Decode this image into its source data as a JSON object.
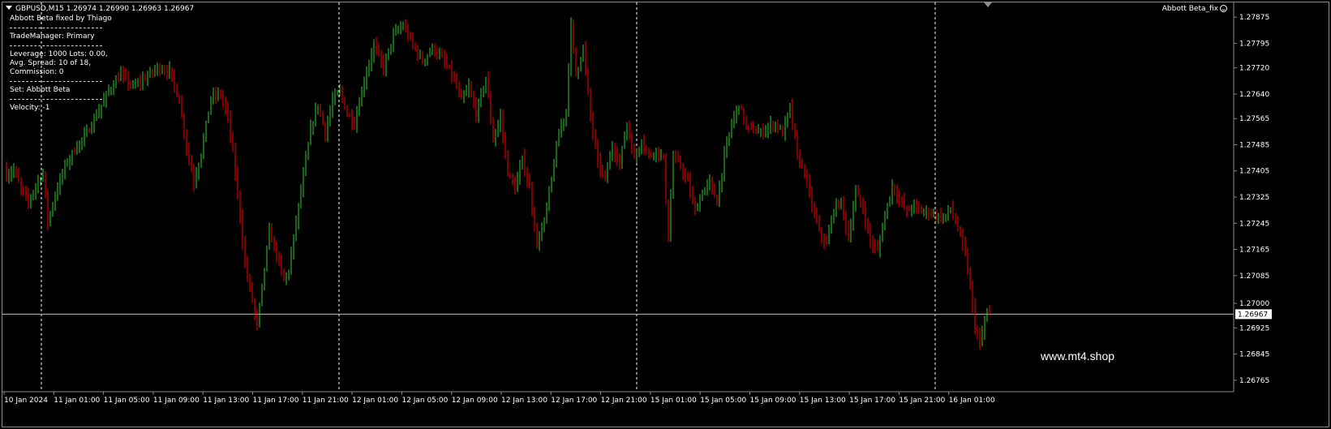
{
  "header": {
    "symbol_line": "GBPUSD,M15  1.26974 1.26990 1.26963 1.26967"
  },
  "info_panel": {
    "title": "Abbott Beta fixed by Thiago",
    "trade_manager": "TradeManager: Primary",
    "leverage_line": "Leverage: 1000 Lots: 0.00,",
    "spread_line": "Avg. Spread: 10 of 18,",
    "commission_line": "Commission: 0",
    "set_line": "Set: Abbott Beta",
    "velocity_line": "Velocity: -1"
  },
  "indicator": {
    "name": "Abbott Beta_fix",
    "icon": "smiley-icon"
  },
  "watermark": "www.mt4.shop",
  "colors": {
    "background": "#000000",
    "bull": "#32cd32",
    "bear": "#ff0000",
    "grid": "#ffffff",
    "price_line": "#c0c0c0",
    "axis_text": "#ffffff"
  },
  "chart_data": {
    "type": "candlestick",
    "symbol": "GBPUSD",
    "timeframe": "M15",
    "ohlc_last": {
      "open": 1.26974,
      "high": 1.2699,
      "low": 1.26963,
      "close": 1.26967
    },
    "current_price": "1.26967",
    "ylim": [
      1.2673,
      1.2792
    ],
    "y_ticks": [
      "1.27875",
      "1.27795",
      "1.27720",
      "1.27640",
      "1.27565",
      "1.27485",
      "1.27405",
      "1.27325",
      "1.27245",
      "1.27165",
      "1.27085",
      "1.27000",
      "1.26925",
      "1.26845",
      "1.26765"
    ],
    "x_ticks": [
      "10 Jan 2024",
      "11 Jan 01:00",
      "11 Jan 05:00",
      "11 Jan 09:00",
      "11 Jan 13:00",
      "11 Jan 17:00",
      "11 Jan 21:00",
      "12 Jan 01:00",
      "12 Jan 05:00",
      "12 Jan 09:00",
      "12 Jan 13:00",
      "12 Jan 17:00",
      "12 Jan 21:00",
      "15 Jan 01:00",
      "15 Jan 05:00",
      "15 Jan 09:00",
      "15 Jan 13:00",
      "15 Jan 17:00",
      "15 Jan 21:00",
      "16 Jan 01:00"
    ],
    "day_separators": [
      "11 Jan 2024",
      "12 Jan 2024",
      "15 Jan 2024",
      "16 Jan 2024"
    ],
    "close_path": [
      [
        0,
        1.2739
      ],
      [
        3,
        1.2741
      ],
      [
        6,
        1.2735
      ],
      [
        9,
        1.2731
      ],
      [
        12,
        1.2736
      ],
      [
        15,
        1.274
      ],
      [
        17,
        1.2725
      ],
      [
        20,
        1.2733
      ],
      [
        24,
        1.2742
      ],
      [
        28,
        1.2747
      ],
      [
        33,
        1.2752
      ],
      [
        38,
        1.2759
      ],
      [
        42,
        1.2765
      ],
      [
        47,
        1.277
      ],
      [
        52,
        1.2766
      ],
      [
        57,
        1.2769
      ],
      [
        62,
        1.2772
      ],
      [
        67,
        1.2771
      ],
      [
        71,
        1.2762
      ],
      [
        74,
        1.2748
      ],
      [
        77,
        1.2737
      ],
      [
        80,
        1.2746
      ],
      [
        84,
        1.2763
      ],
      [
        88,
        1.2764
      ],
      [
        91,
        1.2757
      ],
      [
        93,
        1.2746
      ],
      [
        96,
        1.2727
      ],
      [
        98,
        1.2712
      ],
      [
        101,
        1.2701
      ],
      [
        103,
        1.2693
      ],
      [
        105,
        1.2705
      ],
      [
        108,
        1.2722
      ],
      [
        111,
        1.2715
      ],
      [
        114,
        1.2707
      ],
      [
        116,
        1.271
      ],
      [
        119,
        1.2725
      ],
      [
        122,
        1.2739
      ],
      [
        125,
        1.2753
      ],
      [
        128,
        1.2761
      ],
      [
        131,
        1.2752
      ],
      [
        134,
        1.2762
      ],
      [
        137,
        1.2765
      ],
      [
        140,
        1.2758
      ],
      [
        143,
        1.2755
      ],
      [
        147,
        1.2768
      ],
      [
        151,
        1.2779
      ],
      [
        155,
        1.2772
      ],
      [
        159,
        1.2782
      ],
      [
        163,
        1.2785
      ],
      [
        167,
        1.2779
      ],
      [
        171,
        1.2774
      ],
      [
        175,
        1.2778
      ],
      [
        179,
        1.2775
      ],
      [
        183,
        1.277
      ],
      [
        187,
        1.2762
      ],
      [
        190,
        1.2766
      ],
      [
        193,
        1.2758
      ],
      [
        197,
        1.2769
      ],
      [
        200,
        1.275
      ],
      [
        203,
        1.2757
      ],
      [
        206,
        1.274
      ],
      [
        209,
        1.2735
      ],
      [
        212,
        1.2744
      ],
      [
        215,
        1.2735
      ],
      [
        218,
        1.2718
      ],
      [
        221,
        1.2725
      ],
      [
        224,
        1.2738
      ],
      [
        227,
        1.2752
      ],
      [
        230,
        1.2759
      ],
      [
        232,
        1.2785
      ],
      [
        234,
        1.277
      ],
      [
        237,
        1.2778
      ],
      [
        240,
        1.2757
      ],
      [
        243,
        1.2743
      ],
      [
        246,
        1.2738
      ],
      [
        249,
        1.2748
      ],
      [
        252,
        1.2743
      ],
      [
        255,
        1.2755
      ],
      [
        258,
        1.2744
      ],
      [
        261,
        1.275
      ],
      [
        264,
        1.2745
      ],
      [
        267,
        1.2747
      ],
      [
        270,
        1.2744
      ],
      [
        272,
        1.272
      ],
      [
        274,
        1.2745
      ],
      [
        277,
        1.2742
      ],
      [
        280,
        1.2737
      ],
      [
        283,
        1.2728
      ],
      [
        286,
        1.2734
      ],
      [
        289,
        1.2737
      ],
      [
        292,
        1.2731
      ],
      [
        295,
        1.2745
      ],
      [
        298,
        1.2755
      ],
      [
        301,
        1.2761
      ],
      [
        304,
        1.2754
      ],
      [
        307,
        1.2753
      ],
      [
        310,
        1.2752
      ],
      [
        313,
        1.2754
      ],
      [
        316,
        1.2755
      ],
      [
        319,
        1.2752
      ],
      [
        322,
        1.276
      ],
      [
        325,
        1.2745
      ],
      [
        328,
        1.274
      ],
      [
        331,
        1.273
      ],
      [
        334,
        1.2722
      ],
      [
        337,
        1.2718
      ],
      [
        340,
        1.2729
      ],
      [
        343,
        1.2731
      ],
      [
        346,
        1.272
      ],
      [
        349,
        1.2734
      ],
      [
        352,
        1.2729
      ],
      [
        355,
        1.2719
      ],
      [
        358,
        1.2716
      ],
      [
        361,
        1.2727
      ],
      [
        364,
        1.2736
      ],
      [
        367,
        1.2732
      ],
      [
        370,
        1.2728
      ],
      [
        373,
        1.273
      ],
      [
        376,
        1.2728
      ],
      [
        379,
        1.2728
      ],
      [
        382,
        1.2727
      ],
      [
        385,
        1.2726
      ],
      [
        388,
        1.2729
      ],
      [
        391,
        1.2723
      ],
      [
        394,
        1.2715
      ],
      [
        396,
        1.2705
      ],
      [
        398,
        1.2693
      ],
      [
        400,
        1.2687
      ],
      [
        402,
        1.2695
      ],
      [
        404,
        1.2697
      ]
    ]
  }
}
